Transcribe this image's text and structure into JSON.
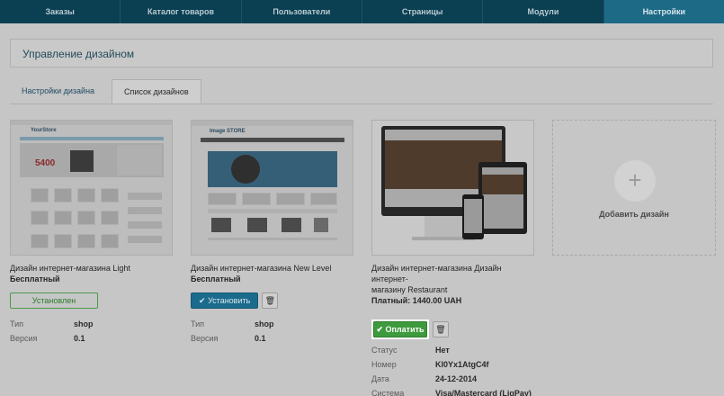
{
  "nav": {
    "items": [
      "Заказы",
      "Каталог товаров",
      "Пользователи",
      "Страницы",
      "Модули",
      "Настройки"
    ],
    "active_index": 5
  },
  "page": {
    "title": "Управление дизайном"
  },
  "tabs": [
    "Настройки дизайна",
    "Список дизайнов"
  ],
  "designs": [
    {
      "name": "Дизайн интернет-магазина Light",
      "price": "Бесплатный",
      "action": "Установлен",
      "meta": [
        {
          "label": "Тип",
          "value": "shop"
        },
        {
          "label": "Версия",
          "value": "0.1"
        }
      ],
      "thumb": {
        "brand": "YourStore",
        "promo": "5400"
      }
    },
    {
      "name": "Дизайн интернет-магазина New Level",
      "price": "Бесплатный",
      "action": "Установить",
      "meta": [
        {
          "label": "Тип",
          "value": "shop"
        },
        {
          "label": "Версия",
          "value": "0.1"
        }
      ],
      "thumb": {
        "brand": "Image STORE"
      }
    },
    {
      "name_line1": "Дизайн интернет-магазина Дизайн интернет-",
      "name_line2": "магазину Restaurant",
      "price": "Платный: 1440.00 UAH",
      "action": "Оплатить",
      "meta": [
        {
          "label": "Статус",
          "value": "Нет"
        },
        {
          "label": "Номер",
          "value": "KI0Yx1AtgC4f"
        },
        {
          "label": "Дата",
          "value": "24-12-2014"
        },
        {
          "label": "Система Оплаты",
          "value": "Visa/Mastercard (LiqPay)"
        }
      ]
    }
  ],
  "add_design": {
    "label": "Добавить дизайн",
    "icon": "plus-icon"
  },
  "colors": {
    "nav_bg": "#0b3f52",
    "nav_active": "#1d6a86",
    "install_button": "#1b6b8c",
    "pay_button": "#3d9a3d",
    "installed_border": "#4d9a4d"
  }
}
